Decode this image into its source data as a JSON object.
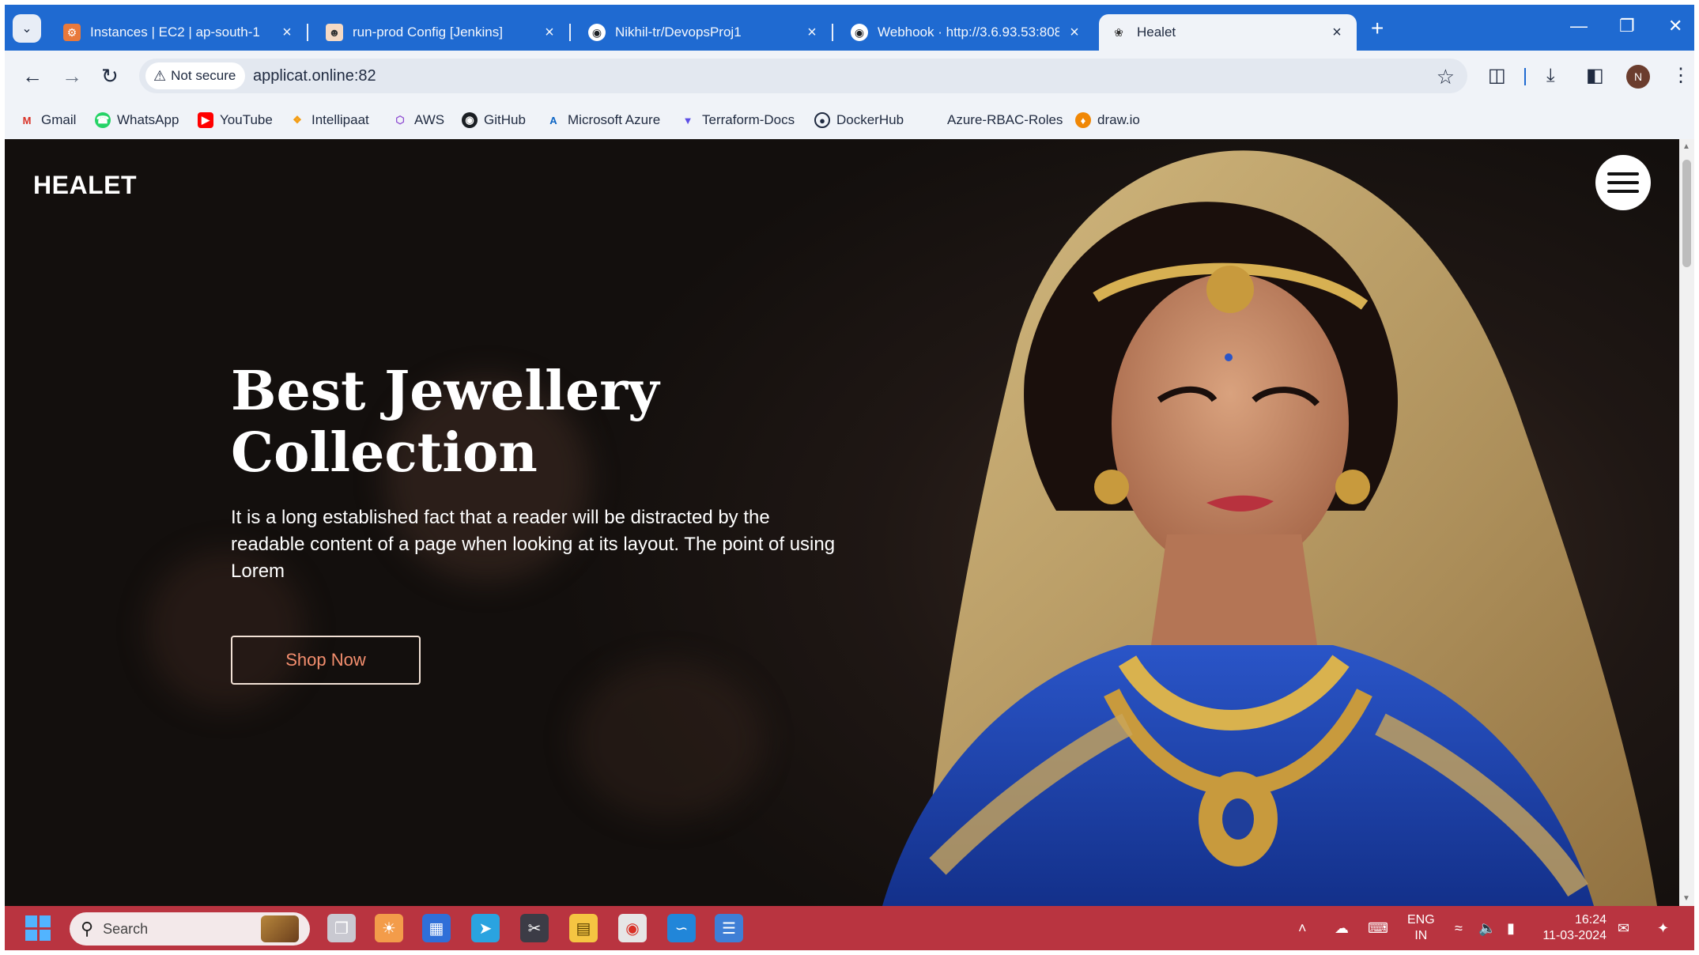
{
  "browser": {
    "tabs": [
      {
        "title": "Instances | EC2 | ap-south-1",
        "icon": "aws-icon",
        "active": false
      },
      {
        "title": "run-prod Config [Jenkins]",
        "icon": "jenkins-icon",
        "active": false
      },
      {
        "title": "Nikhil-tr/DevopsProj1",
        "icon": "github-icon",
        "active": false
      },
      {
        "title": "Webhook · http://3.6.93.53:808",
        "icon": "github-icon",
        "active": false
      },
      {
        "title": "Healet",
        "icon": "healet-icon",
        "active": true
      }
    ],
    "security_label": "Not secure",
    "url": "applicat.online:82",
    "profile_initial": "N",
    "bookmarks": [
      {
        "label": "Gmail",
        "icon": "gmail-icon"
      },
      {
        "label": "WhatsApp",
        "icon": "whatsapp-icon"
      },
      {
        "label": "YouTube",
        "icon": "youtube-icon"
      },
      {
        "label": "Intellipaat",
        "icon": "intellipaat-icon"
      },
      {
        "label": "AWS",
        "icon": "aws-icon"
      },
      {
        "label": "GitHub",
        "icon": "github-icon"
      },
      {
        "label": "Microsoft Azure",
        "icon": "azure-icon"
      },
      {
        "label": "Terraform-Docs",
        "icon": "terraform-icon"
      },
      {
        "label": "DockerHub",
        "icon": "docker-icon"
      },
      {
        "label": "Azure-RBAC-Roles",
        "icon": "microsoft-icon"
      },
      {
        "label": "draw.io",
        "icon": "drawio-icon"
      }
    ]
  },
  "page": {
    "brand": "HEALET",
    "hero_title_line1": "Best Jewellery",
    "hero_title_line2": "Collection",
    "hero_text": "It is a long established fact that a reader will be distracted by the readable content of a page when looking at its layout. The point of using Lorem",
    "cta_label": "Shop Now",
    "cta_color": "#f38e6e"
  },
  "taskbar": {
    "search_placeholder": "Search",
    "language_line1": "ENG",
    "language_line2": "IN",
    "time": "16:24",
    "date": "11-03-2024",
    "color": "#b93440"
  }
}
